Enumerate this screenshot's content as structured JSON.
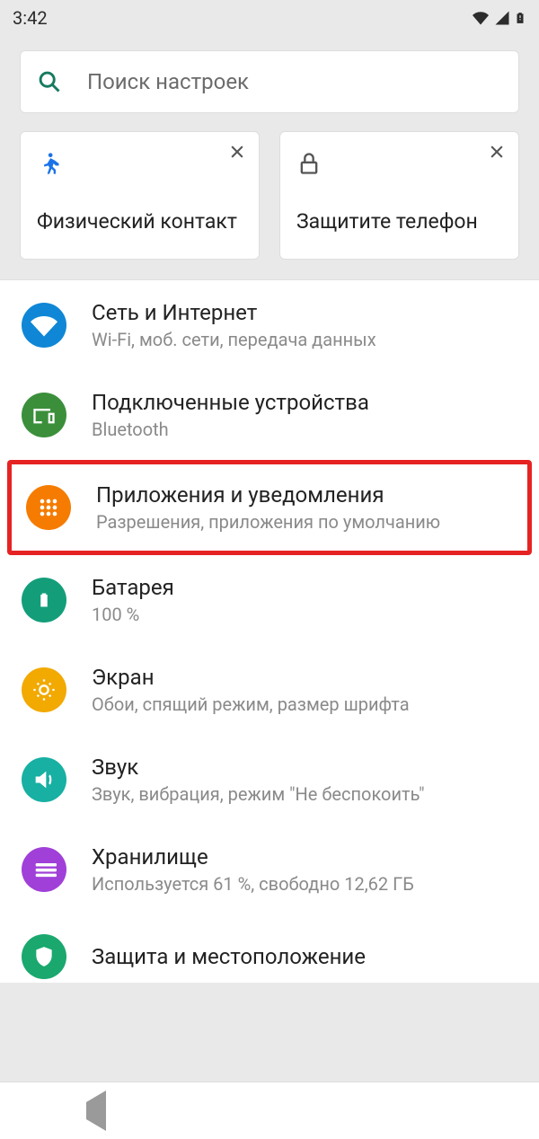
{
  "statusbar": {
    "time": "3:42"
  },
  "search": {
    "placeholder": "Поиск настроек"
  },
  "cards": [
    {
      "title": "Физический контакт"
    },
    {
      "title": "Защитите телефон"
    }
  ],
  "items": [
    {
      "title": "Сеть и Интернет",
      "subtitle": "Wi-Fi, моб. сети, передача данных",
      "color": "#0f87d6",
      "icon": "wifi"
    },
    {
      "title": "Подключенные устройства",
      "subtitle": "Bluetooth",
      "color": "#3b8f3b",
      "icon": "devices"
    },
    {
      "title": "Приложения и уведомления",
      "subtitle": "Разрешения, приложения по умолчанию",
      "color": "#f57c00",
      "icon": "apps",
      "highlight": true
    },
    {
      "title": "Батарея",
      "subtitle": "100 %",
      "color": "#139e79",
      "icon": "battery"
    },
    {
      "title": "Экран",
      "subtitle": "Обои, спящий режим, размер шрифта",
      "color": "#f2a900",
      "icon": "display"
    },
    {
      "title": "Звук",
      "subtitle": "Звук, вибрация, режим \"Не беспокоить\"",
      "color": "#17b0a3",
      "icon": "sound"
    },
    {
      "title": "Хранилище",
      "subtitle": "Используется 61 %, свободно 12,62 ГБ",
      "color": "#a040d8",
      "icon": "storage"
    },
    {
      "title": "Защита и местоположение",
      "subtitle": "",
      "color": "#1aa86e",
      "icon": "security"
    }
  ]
}
